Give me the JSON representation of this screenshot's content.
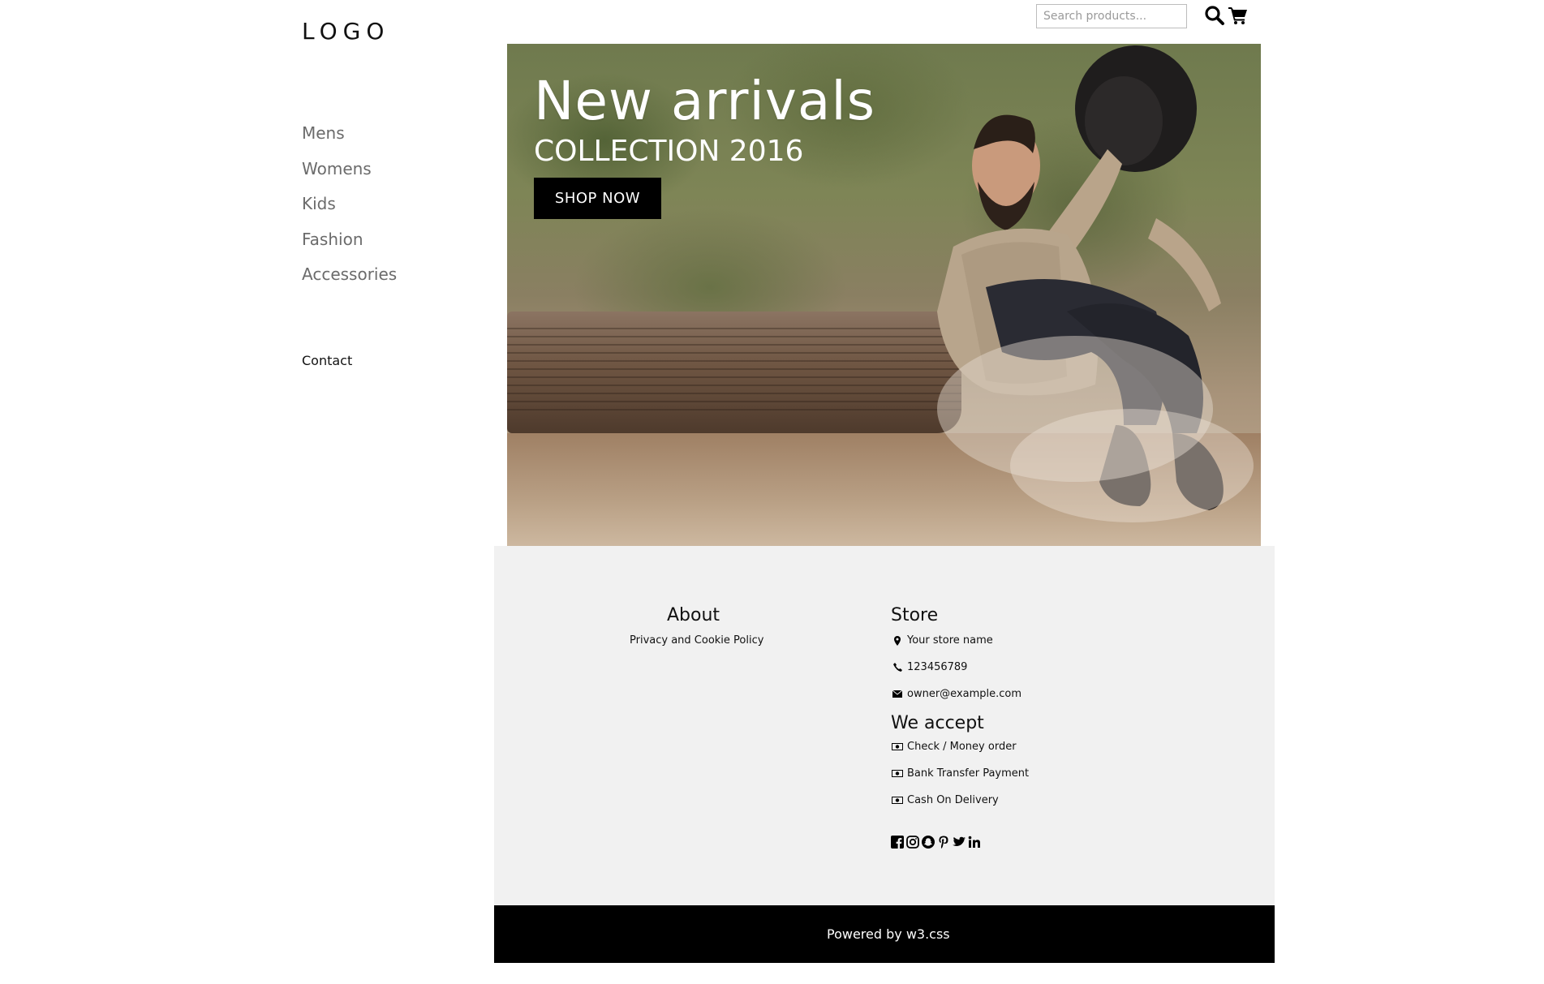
{
  "header": {
    "logo_text": "LOGO",
    "search_placeholder": "Search products...",
    "search_icon": "search-icon",
    "cart_icon": "cart-icon"
  },
  "sidebar": {
    "items": [
      {
        "label": "Mens"
      },
      {
        "label": "Womens"
      },
      {
        "label": "Kids"
      },
      {
        "label": "Fashion"
      },
      {
        "label": "Accessories"
      }
    ],
    "contact_label": "Contact"
  },
  "hero": {
    "title": "New arrivals",
    "subtitle": "COLLECTION 2016",
    "button_label": "SHOP NOW"
  },
  "footer": {
    "about_title": "About",
    "about_link": "Privacy and Cookie Policy",
    "store_title": "Store",
    "store_lines": [
      {
        "icon": "map-marker-icon",
        "text": "Your store name"
      },
      {
        "icon": "phone-icon",
        "text": "123456789"
      },
      {
        "icon": "envelope-icon",
        "text": "owner@example.com"
      }
    ],
    "accept_title": "We accept",
    "payment_lines": [
      {
        "icon": "money-icon",
        "text": "Check / Money order"
      },
      {
        "icon": "money-icon",
        "text": "Bank Transfer Payment"
      },
      {
        "icon": "money-icon",
        "text": "Cash On Delivery"
      }
    ],
    "social_icons": [
      "facebook-icon",
      "instagram-icon",
      "snapchat-icon",
      "pinterest-icon",
      "twitter-icon",
      "linkedin-icon"
    ],
    "powered_by": "Powered by w3.css"
  },
  "colors": {
    "footer_bg": "#f1f1f1",
    "bottom_bar_bg": "#000000",
    "nav_text": "#6b6b6b",
    "button_bg": "#000000"
  }
}
